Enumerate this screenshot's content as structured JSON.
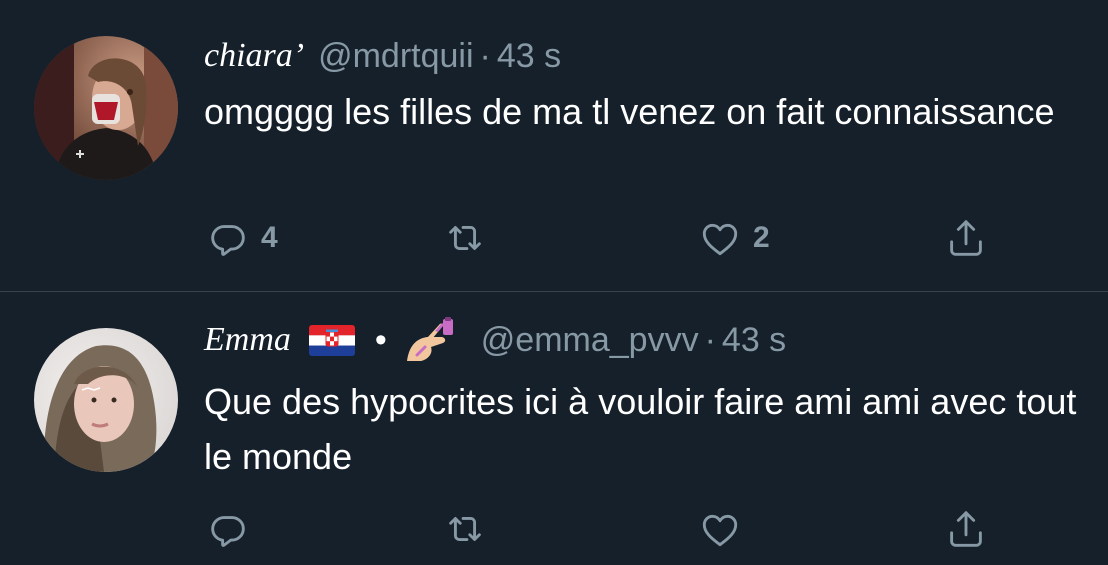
{
  "tweets": [
    {
      "display_name": "chiara’",
      "handle": "@mdrtquii",
      "separator": "·",
      "time": "43 s",
      "text": "omgggg les filles de ma tl venez on fait connaissance",
      "reply_count": "4",
      "retweet_count": "",
      "like_count": "2",
      "avatar_icon": "profile-photo-chiara"
    },
    {
      "display_name": "Emma",
      "name_emojis": [
        "croatia-flag",
        "bullet",
        "nail-polish"
      ],
      "bullet": "•",
      "handle": "@emma_pvvv",
      "separator": "·",
      "time": "43 s",
      "text": "Que des hypocrites ici à vouloir faire ami ami avec tout le monde",
      "reply_count": "",
      "retweet_count": "",
      "like_count": "",
      "avatar_icon": "profile-photo-emma"
    }
  ],
  "icons": {
    "reply": "reply-icon",
    "retweet": "retweet-icon",
    "like": "heart-icon",
    "share": "share-icon"
  },
  "colors": {
    "background": "#15202b",
    "secondary_text": "#8899a6",
    "divider": "#38444d"
  }
}
